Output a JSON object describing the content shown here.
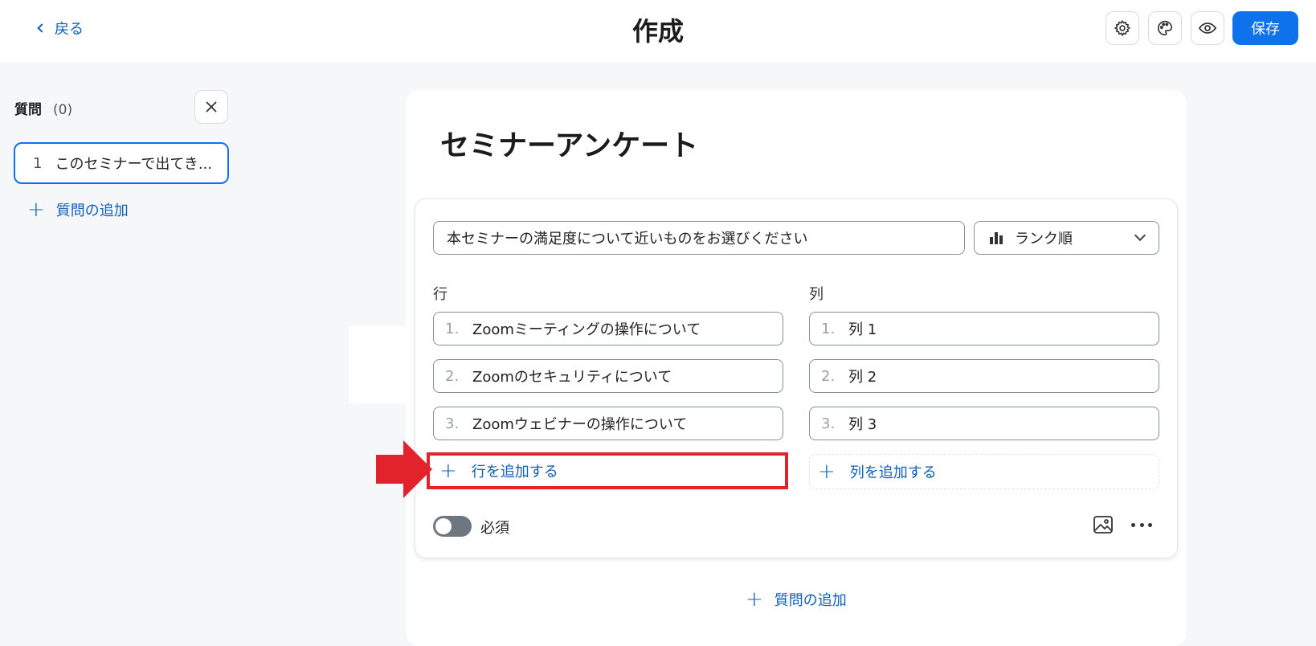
{
  "header": {
    "back_label": "戻る",
    "title": "作成",
    "icons": [
      "gear-icon",
      "palette-icon",
      "eye-icon"
    ],
    "save_label": "保存",
    "accent_color": "#0e72ed"
  },
  "sidebar": {
    "title": "質問",
    "count": "(0)",
    "items": [
      {
        "number": "1",
        "label": "このセミナーで出てき..."
      }
    ],
    "add_question_label": "質問の追加"
  },
  "survey": {
    "title": "セミナーアンケート",
    "question": {
      "text": "本セミナーの満足度について近いものをお選びください",
      "type_label": "ランク順",
      "rows_label": "行",
      "columns_label": "列",
      "rows": [
        {
          "number": "1.",
          "label": "Zoomミーティングの操作について"
        },
        {
          "number": "2.",
          "label": "Zoomのセキュリティについて"
        },
        {
          "number": "3.",
          "label": "Zoomウェビナーの操作について"
        }
      ],
      "columns": [
        {
          "number": "1.",
          "label": "列 1"
        },
        {
          "number": "2.",
          "label": "列 2"
        },
        {
          "number": "3.",
          "label": "列 3"
        }
      ],
      "add_row_label": "行を追加する",
      "add_column_label": "列を追加する",
      "required_label": "必須",
      "required_on": false
    },
    "add_question_label": "質問の追加"
  },
  "highlight_color": "#e3232b"
}
